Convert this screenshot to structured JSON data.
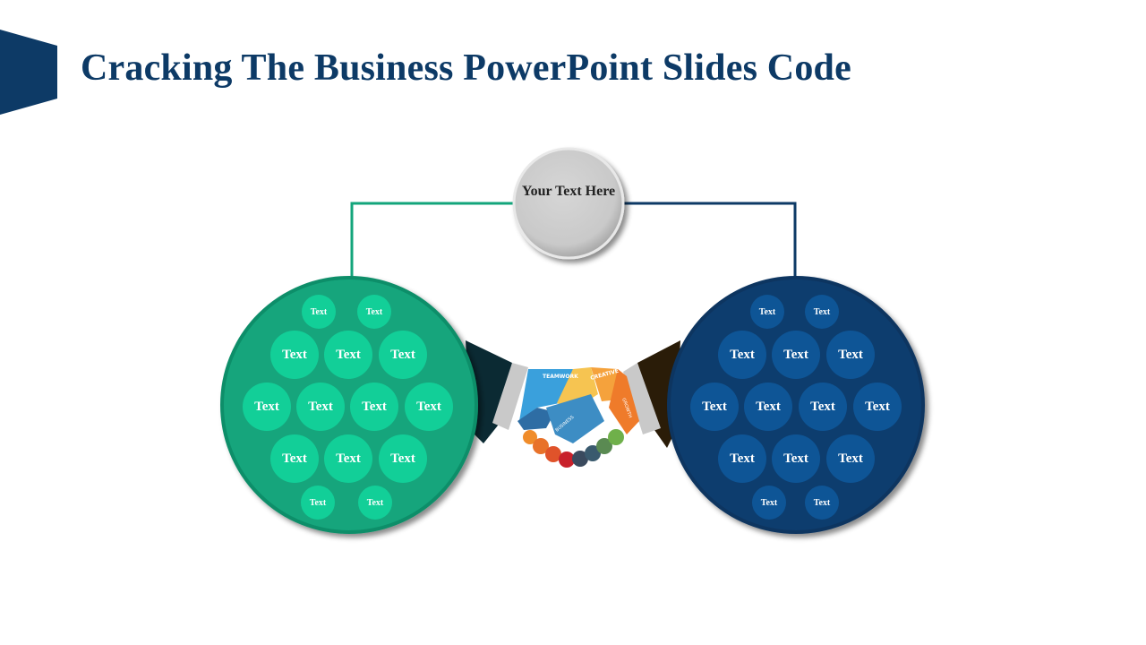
{
  "slide": {
    "title": "Cracking The Business PowerPoint Slides Code",
    "center_node": {
      "text": "Your Text Here"
    },
    "colors": {
      "accent_dark_blue": "#0d3a66",
      "green": "#13a57b",
      "green_bubble": "#12cf98",
      "blue": "#0c3d6e",
      "blue_bubble": "#0e5596",
      "center_gray": "#cccccc"
    },
    "handshake_labels": [
      "TEAMWORK",
      "CREATIVE",
      "GROWTH",
      "BUSINESS"
    ],
    "left_group": {
      "bubbles": [
        "Text",
        "Text",
        "Text",
        "Text",
        "Text",
        "Text",
        "Text",
        "Text",
        "Text",
        "Text",
        "Text",
        "Text",
        "Text",
        "Text"
      ]
    },
    "right_group": {
      "bubbles": [
        "Text",
        "Text",
        "Text",
        "Text",
        "Text",
        "Text",
        "Text",
        "Text",
        "Text",
        "Text",
        "Text",
        "Text",
        "Text",
        "Text"
      ]
    }
  }
}
